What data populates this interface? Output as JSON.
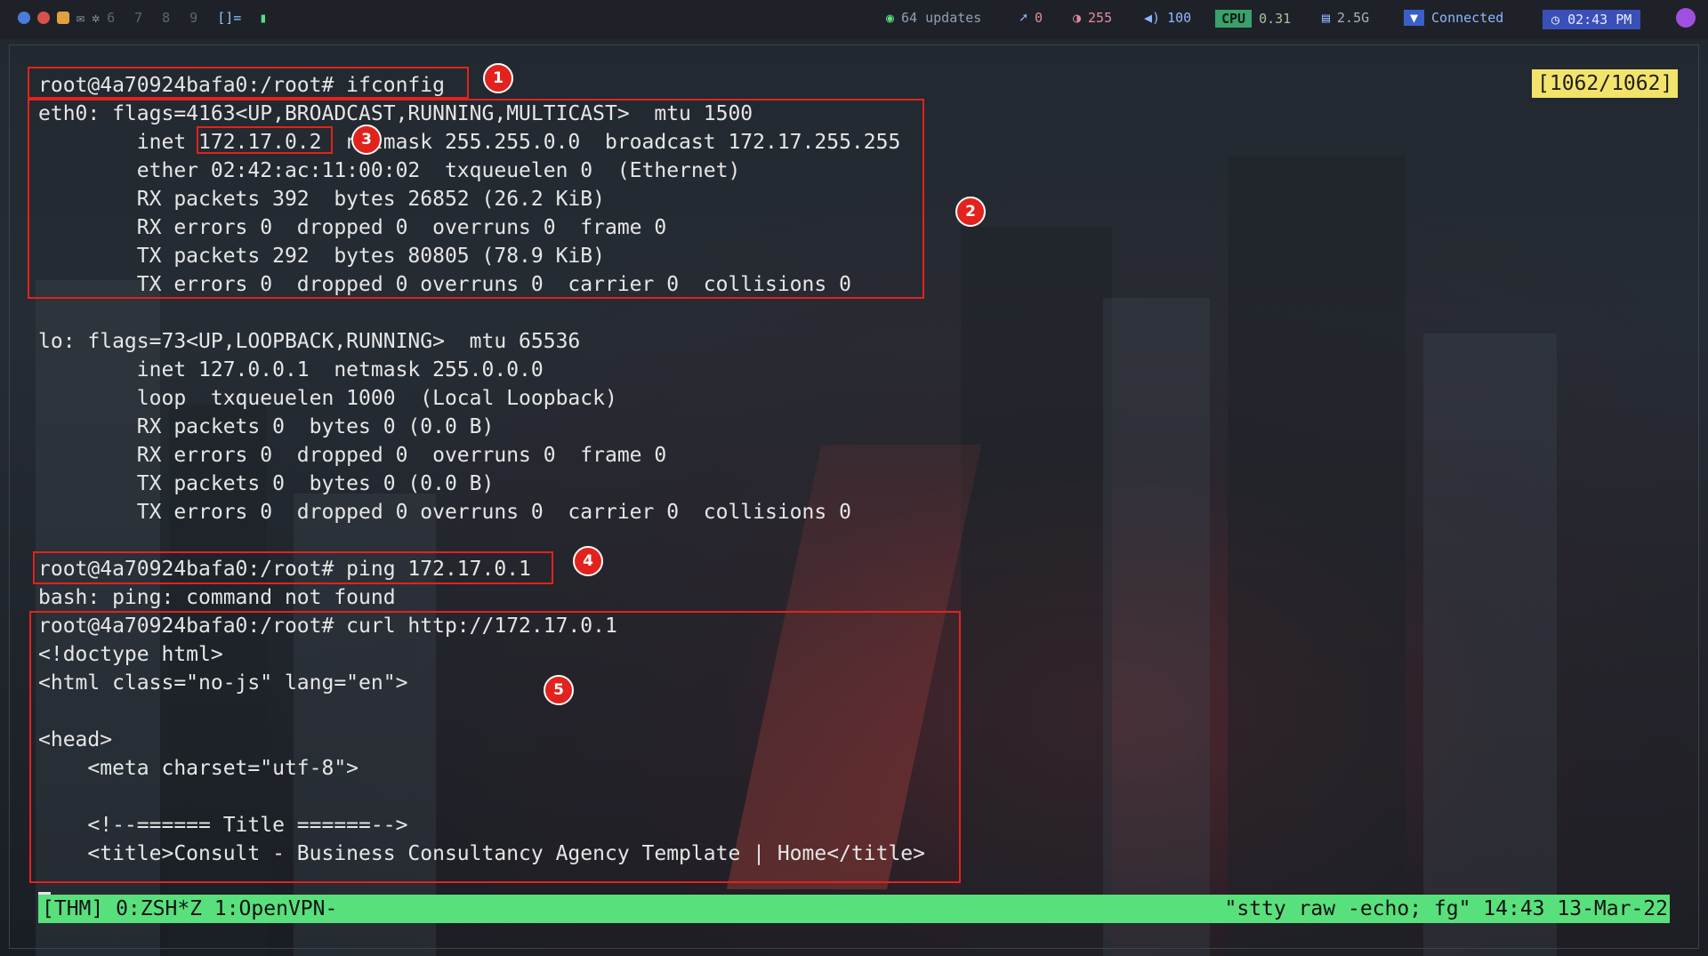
{
  "topbar": {
    "workspaces": [
      "6",
      "7",
      "8",
      "9"
    ],
    "layout": "[]=",
    "updates": "64 updates",
    "notifications": "0",
    "brightness": "255",
    "volume": "100",
    "cpu_label": "CPU",
    "cpu_value": "0.31",
    "memory": "2.5G",
    "vpn_status": "Connected",
    "time": "02:43 PM"
  },
  "terminal": {
    "scroll_counter": "[1062/1062]",
    "lines": [
      "root@4a70924bafa0:/root# ifconfig",
      "eth0: flags=4163<UP,BROADCAST,RUNNING,MULTICAST>  mtu 1500",
      "        inet 172.17.0.2  netmask 255.255.0.0  broadcast 172.17.255.255",
      "        ether 02:42:ac:11:00:02  txqueuelen 0  (Ethernet)",
      "        RX packets 392  bytes 26852 (26.2 KiB)",
      "        RX errors 0  dropped 0  overruns 0  frame 0",
      "        TX packets 292  bytes 80805 (78.9 KiB)",
      "        TX errors 0  dropped 0 overruns 0  carrier 0  collisions 0",
      "",
      "lo: flags=73<UP,LOOPBACK,RUNNING>  mtu 65536",
      "        inet 127.0.0.1  netmask 255.0.0.0",
      "        loop  txqueuelen 1000  (Local Loopback)",
      "        RX packets 0  bytes 0 (0.0 B)",
      "        RX errors 0  dropped 0  overruns 0  frame 0",
      "        TX packets 0  bytes 0 (0.0 B)",
      "        TX errors 0  dropped 0 overruns 0  carrier 0  collisions 0",
      "",
      "root@4a70924bafa0:/root# ping 172.17.0.1",
      "bash: ping: command not found",
      "root@4a70924bafa0:/root# curl http://172.17.0.1",
      "<!doctype html>",
      "<html class=\"no-js\" lang=\"en\">",
      "",
      "<head>",
      "    <meta charset=\"utf-8\">",
      "",
      "    <!--====== Title ======-->",
      "    <title>Consult - Business Consultancy Agency Template | Home</title>"
    ]
  },
  "annotations": [
    "1",
    "2",
    "3",
    "4",
    "5"
  ],
  "statusbar": {
    "left": "[THM] 0:ZSH*Z 1:OpenVPN-",
    "right": "\"stty raw -echo; fg\" 14:43 13-Mar-22"
  },
  "colors": {
    "accent_red": "#e2221d",
    "status_green": "#58e07c",
    "counter_yellow": "#f2e46a"
  }
}
